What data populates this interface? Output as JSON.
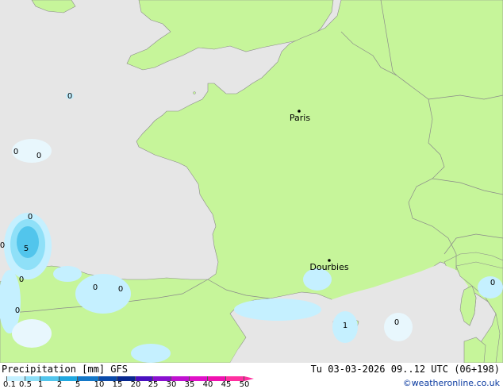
{
  "map": {
    "cities": [
      {
        "name": "Paris"
      },
      {
        "name": "Dourbies"
      }
    ],
    "contour_values": [
      "0",
      "0",
      "0",
      "0",
      "5",
      "0",
      "0",
      "0",
      "0",
      "0",
      "1",
      "0",
      "0"
    ]
  },
  "legend": {
    "title": "Precipitation [mm]",
    "model": "GFS",
    "ticks": [
      "0.1",
      "0.5",
      "1",
      "2",
      "5",
      "10",
      "15",
      "20",
      "25",
      "30",
      "35",
      "40",
      "45",
      "50"
    ],
    "colors": [
      "#f5fbff",
      "#c5f0ff",
      "#8fe0f8",
      "#52c5ec",
      "#20a8e0",
      "#1478c8",
      "#0a4aaa",
      "#082890",
      "#4a10c0",
      "#8a10d0",
      "#c010d0",
      "#e010c8",
      "#f010b0",
      "#ff30a0"
    ]
  },
  "footer": {
    "datetime": "Tu 03-03-2026 09..12 UTC (06+198)",
    "credit": "©weatheronline.co.uk"
  },
  "colors": {
    "land": "#c6f59a",
    "sea": "#e6e6e6",
    "border": "#8a8a8a"
  }
}
